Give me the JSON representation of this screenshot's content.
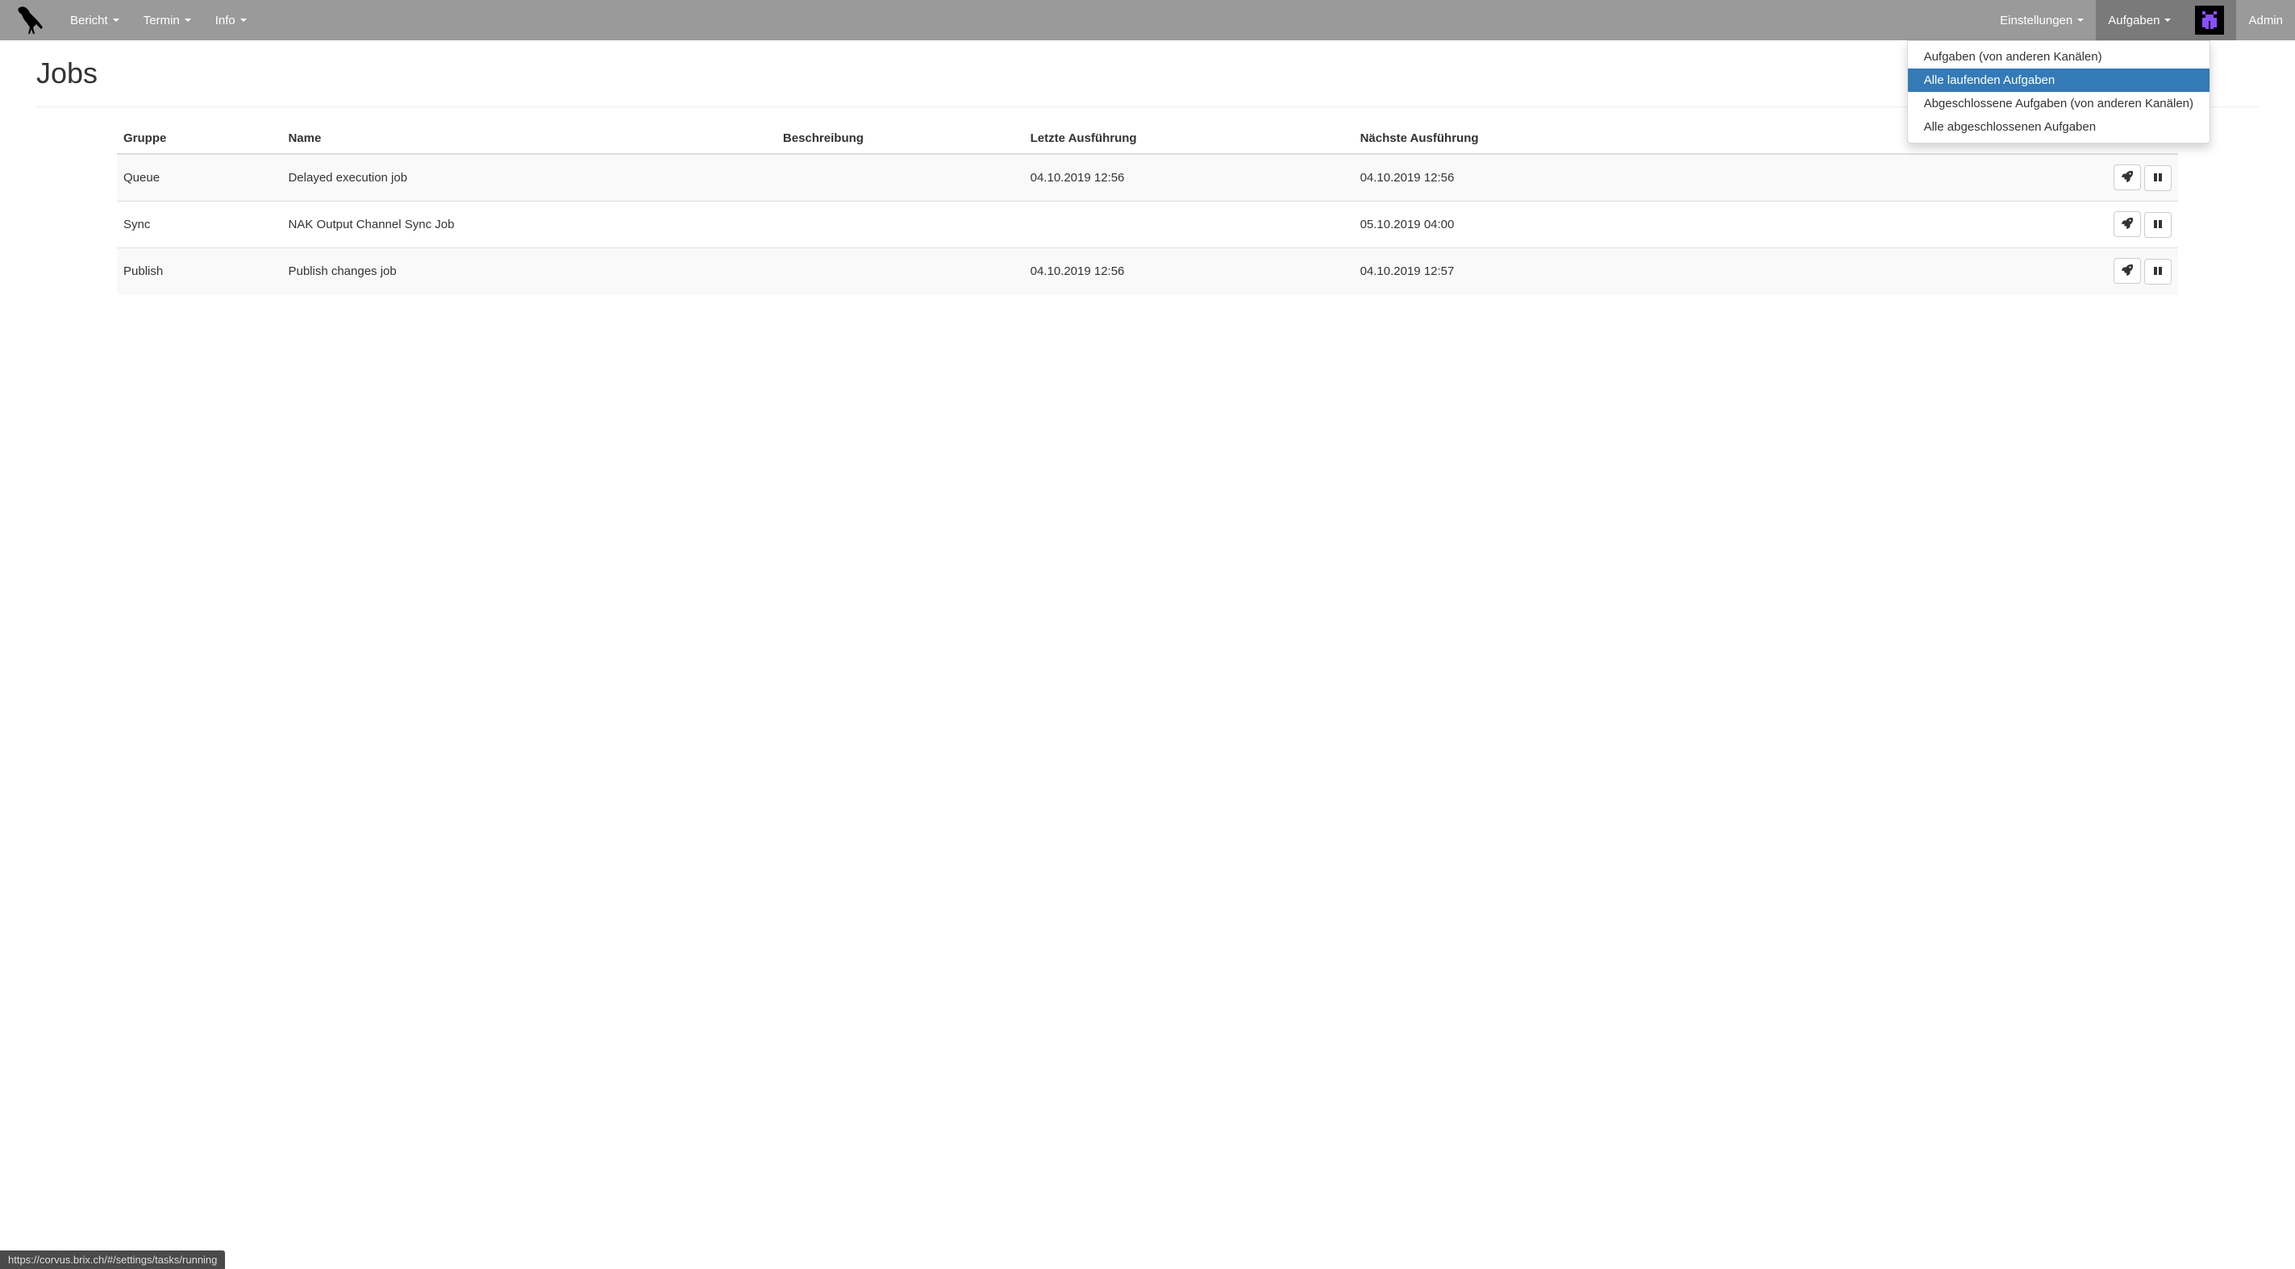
{
  "nav": {
    "bericht": "Bericht",
    "termin": "Termin",
    "info": "Info",
    "einstellungen": "Einstellungen",
    "aufgaben": "Aufgaben",
    "admin": "Admin"
  },
  "dropdown": {
    "items": [
      {
        "label": "Aufgaben (von anderen Kanälen)",
        "highlighted": false
      },
      {
        "label": "Alle laufenden Aufgaben",
        "highlighted": true
      },
      {
        "label": "Abgeschlossene Aufgaben (von anderen Kanälen)",
        "highlighted": false
      },
      {
        "label": "Alle abgeschlossenen Aufgaben",
        "highlighted": false
      }
    ]
  },
  "page": {
    "title": "Jobs"
  },
  "table": {
    "headers": {
      "group": "Gruppe",
      "name": "Name",
      "description": "Beschreibung",
      "last_run": "Letzte Ausführung",
      "next_run": "Nächste Ausführung"
    },
    "rows": [
      {
        "group": "Queue",
        "name": "Delayed execution job",
        "description": "",
        "last_run": "04.10.2019 12:56",
        "next_run": "04.10.2019 12:56"
      },
      {
        "group": "Sync",
        "name": "NAK Output Channel Sync Job",
        "description": "",
        "last_run": "",
        "next_run": "05.10.2019 04:00"
      },
      {
        "group": "Publish",
        "name": "Publish changes job",
        "description": "",
        "last_run": "04.10.2019 12:56",
        "next_run": "04.10.2019 12:57"
      }
    ]
  },
  "status_bar": {
    "url": "https://corvus.brix.ch/#/settings/tasks/running"
  }
}
